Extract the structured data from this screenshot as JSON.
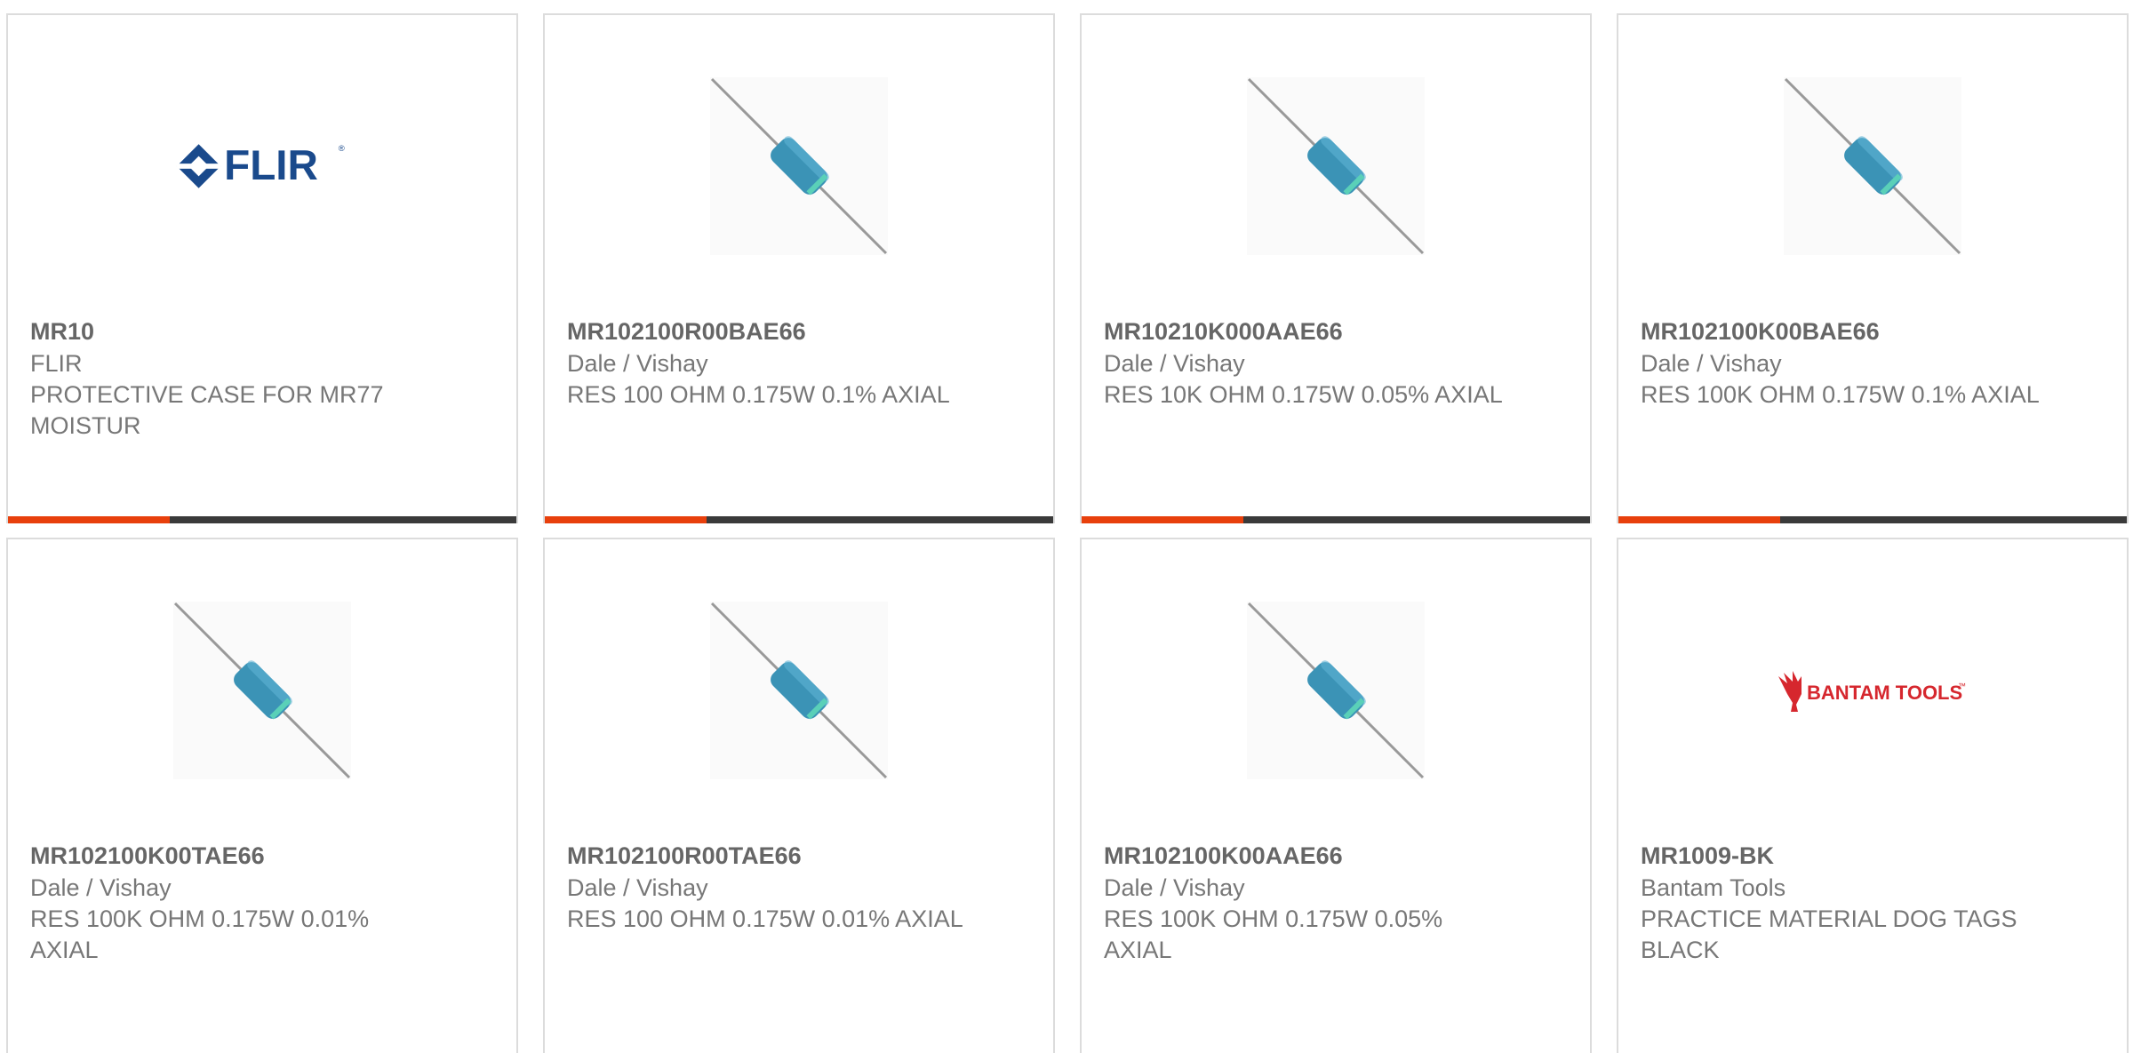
{
  "accent_color": "#e8400c",
  "bar_color": "#3a3a3a",
  "products": [
    {
      "part_number": "MR10",
      "manufacturer": "FLIR",
      "description": "PROTECTIVE CASE FOR MR77 MOISTUR",
      "image": "flir-logo"
    },
    {
      "part_number": "MR102100R00BAE66",
      "manufacturer": "Dale / Vishay",
      "description": "RES 100 OHM 0.175W 0.1% AXIAL",
      "image": "axial-resistor"
    },
    {
      "part_number": "MR10210K000AAE66",
      "manufacturer": "Dale / Vishay",
      "description": "RES 10K OHM 0.175W 0.05% AXIAL",
      "image": "axial-resistor"
    },
    {
      "part_number": "MR102100K00BAE66",
      "manufacturer": "Dale / Vishay",
      "description": "RES 100K OHM 0.175W 0.1% AXIAL",
      "image": "axial-resistor"
    },
    {
      "part_number": "MR102100K00TAE66",
      "manufacturer": "Dale / Vishay",
      "description": "RES 100K OHM 0.175W 0.01% AXIAL",
      "image": "axial-resistor"
    },
    {
      "part_number": "MR102100R00TAE66",
      "manufacturer": "Dale / Vishay",
      "description": "RES 100 OHM 0.175W 0.01% AXIAL",
      "image": "axial-resistor"
    },
    {
      "part_number": "MR102100K00AAE66",
      "manufacturer": "Dale / Vishay",
      "description": "RES 100K OHM 0.175W 0.05% AXIAL",
      "image": "axial-resistor"
    },
    {
      "part_number": "MR1009-BK",
      "manufacturer": "Bantam Tools",
      "description": "PRACTICE MATERIAL DOG TAGS BLACK",
      "image": "bantam-tools-logo"
    }
  ],
  "logos": {
    "flir": {
      "text": "FLIR",
      "registered": "®",
      "color": "#1a4a8c"
    },
    "bantam": {
      "text": "BANTAM TOOLS",
      "trademark": "™",
      "color": "#d6272e"
    }
  }
}
